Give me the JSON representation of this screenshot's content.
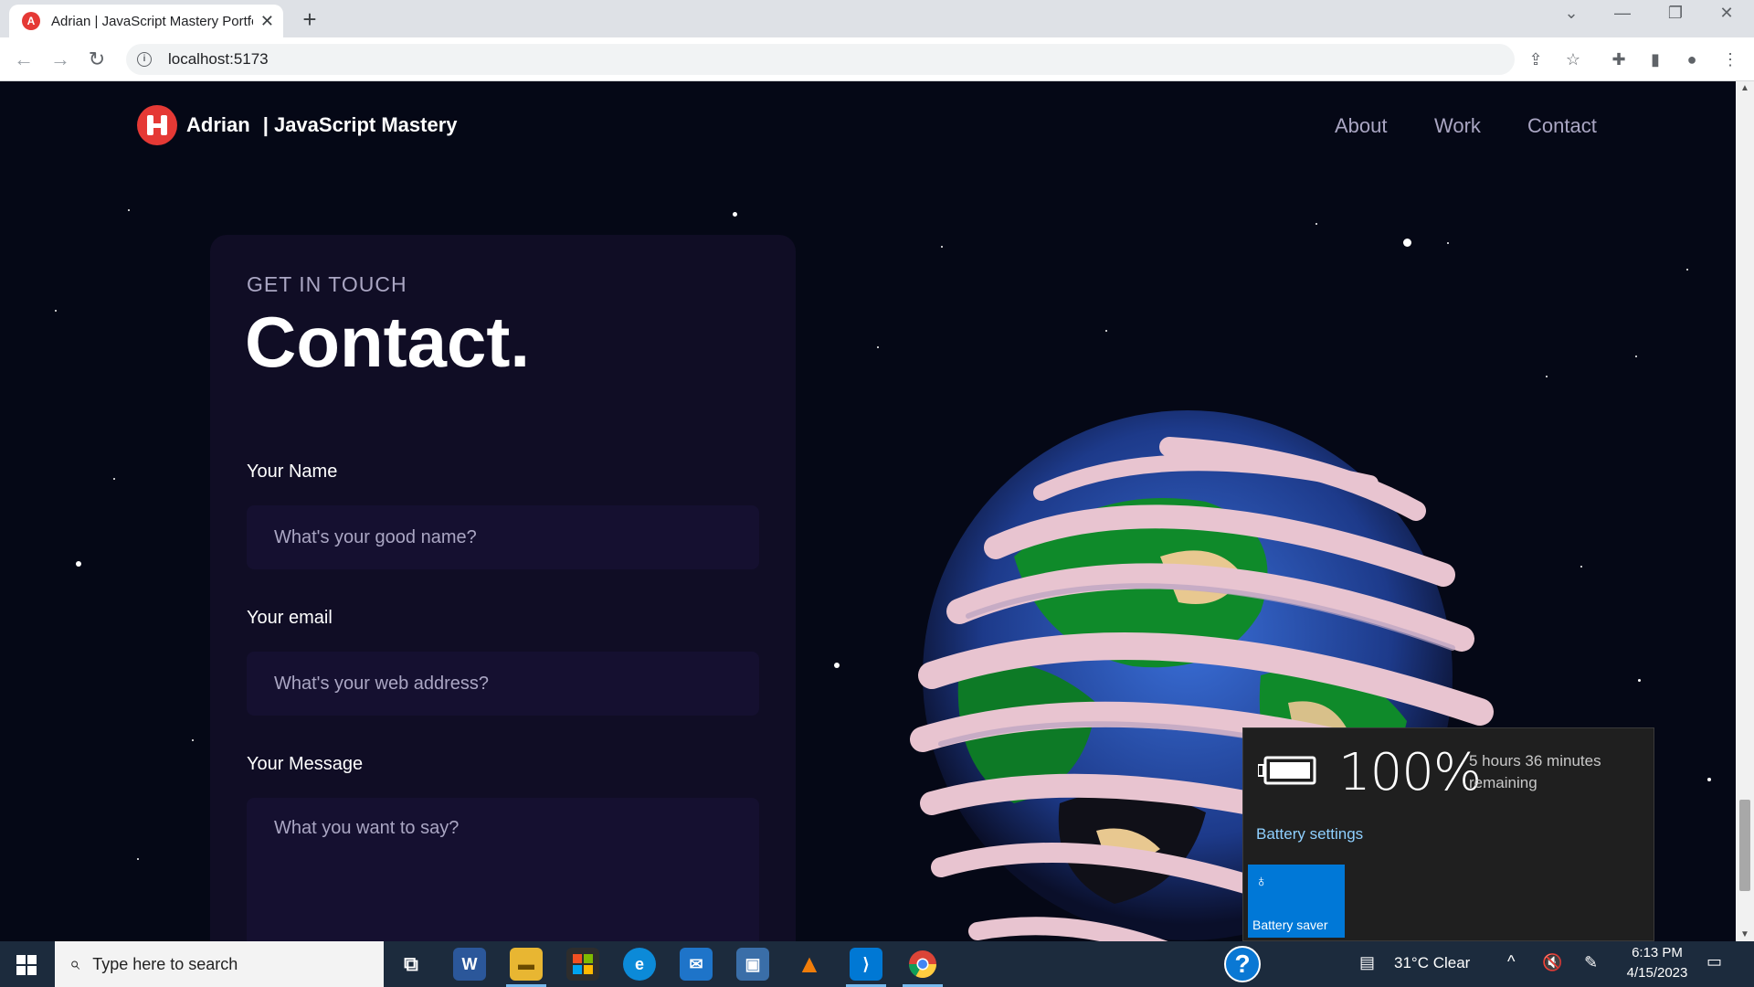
{
  "browser": {
    "tab_title": "Adrian | JavaScript Mastery Portfolio",
    "tab_favicon_letter": "A",
    "new_tab_label": "+",
    "url": "localhost:5173"
  },
  "site": {
    "brand_name": "Adrian",
    "brand_suffix": "| JavaScript Mastery",
    "nav_links": [
      "About",
      "Work",
      "Contact"
    ],
    "accent_color": "#e53935"
  },
  "contact_form": {
    "subtitle": "GET IN TOUCH",
    "heading": "Contact.",
    "fields": [
      {
        "label": "Your Name",
        "placeholder": "What's your good name?"
      },
      {
        "label": "Your email",
        "placeholder": "What's your web address?"
      },
      {
        "label": "Your Message",
        "placeholder": "What you want to say?"
      }
    ]
  },
  "battery_flyout": {
    "percent": "100%",
    "remaining": "5 hours 36 minutes remaining",
    "settings_link": "Battery settings",
    "saver_label": "Battery saver"
  },
  "taskbar": {
    "search_placeholder": "Type here to search",
    "weather": "31°C  Clear",
    "time": "6:13 PM",
    "date": "4/15/2023",
    "apps": [
      "task-view",
      "word",
      "file-explorer",
      "store",
      "edge",
      "mail",
      "remote-desktop",
      "vlc",
      "vscode",
      "chrome"
    ]
  }
}
